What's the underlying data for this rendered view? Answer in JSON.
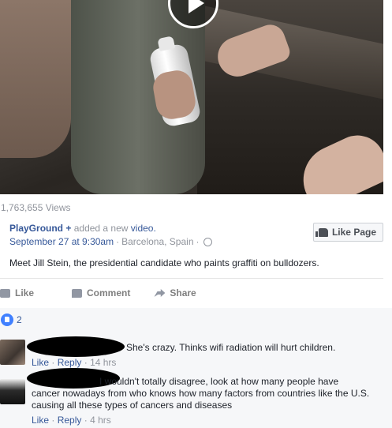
{
  "video": {
    "play_icon": "play-icon"
  },
  "views": "1,763,655 Views",
  "post": {
    "author": "PlayGround",
    "plus": "+",
    "action_text": "added a new",
    "action_link": "video.",
    "date": "September 27 at 9:30am",
    "separator": "·",
    "location": "Barcelona, Spain",
    "like_page_label": "Like Page",
    "caption": "Meet Jill Stein, the presidential candidate who paints graffiti on bulldozers."
  },
  "actions": {
    "like": "Like",
    "comment": "Comment",
    "share": "Share"
  },
  "reactions": {
    "count": "2"
  },
  "comments": [
    {
      "text": "She's crazy. Thinks wifi radiation will hurt children.",
      "like": "Like",
      "reply": "Reply",
      "time": "14 hrs"
    },
    {
      "text_line1": "I wouldn't totally disagree, look at how many people have",
      "text_line2": "cancer nowadays from who knows how many factors from countries like the U.S.",
      "text_line3": "causing all these types of cancers and diseases",
      "like": "Like",
      "reply": "Reply",
      "time": "4 hrs"
    }
  ],
  "colors": {
    "link": "#365899",
    "muted": "#90949c",
    "reaction_blue": "#4080ff"
  }
}
